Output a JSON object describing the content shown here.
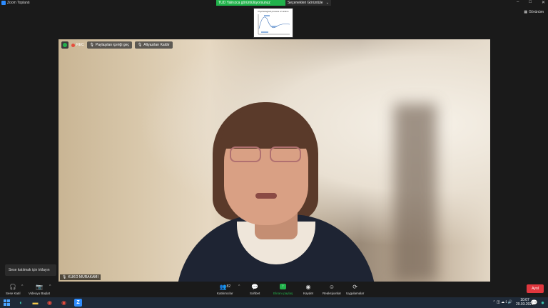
{
  "window": {
    "title": "Zoom Toplantı",
    "controls": [
      "–",
      "□",
      "✕"
    ]
  },
  "share_banner": {
    "status": "TUD Yalnızca görüntülüyorsunuz",
    "view_options": "Seçenekleri Görüntüle",
    "chevron": "⌄"
  },
  "shared_slide": {
    "title": "Psychological process of victims"
  },
  "view_button": {
    "label": "Görünüm"
  },
  "video_toolbar": {
    "rec_label": "REC",
    "pause_share": "Paylaşılan içeriği geç",
    "subtitles": "Altyazıları Kaldır"
  },
  "participant": {
    "name": "KUKO MURAKAMI"
  },
  "tooltip": {
    "text": "Sese katılmak için tıklayın"
  },
  "meeting_controls": [
    {
      "label": "Sese Katıl",
      "icon": "headphones-icon",
      "glyph": "🎧"
    },
    {
      "label": "Videoyu Başlat",
      "icon": "video-off-icon",
      "glyph": "📷"
    },
    {
      "label": "Katılımcılar",
      "icon": "participants-icon",
      "glyph": "👥",
      "count": "82"
    },
    {
      "label": "Sohbet",
      "icon": "chat-icon",
      "glyph": "💬"
    },
    {
      "label": "Ekranı paylaş",
      "icon": "share-screen-icon",
      "glyph": "↑"
    },
    {
      "label": "Kaydet",
      "icon": "record-icon",
      "glyph": "◉"
    },
    {
      "label": "Reaksiyonlar",
      "icon": "reactions-icon",
      "glyph": "☺"
    },
    {
      "label": "Uygulamalar",
      "icon": "apps-icon",
      "glyph": "⟳"
    }
  ],
  "leave_button": {
    "label": "Ayrıl"
  },
  "taskbar": {
    "time": "10:07",
    "date": "20.03.2024",
    "tray_glyphs": "⌃ ◫ ☁ ⟟ 🔊"
  },
  "colors": {
    "accent_green": "#22b14c",
    "leave_red": "#e0373e",
    "zoom_blue": "#2d8cff"
  }
}
